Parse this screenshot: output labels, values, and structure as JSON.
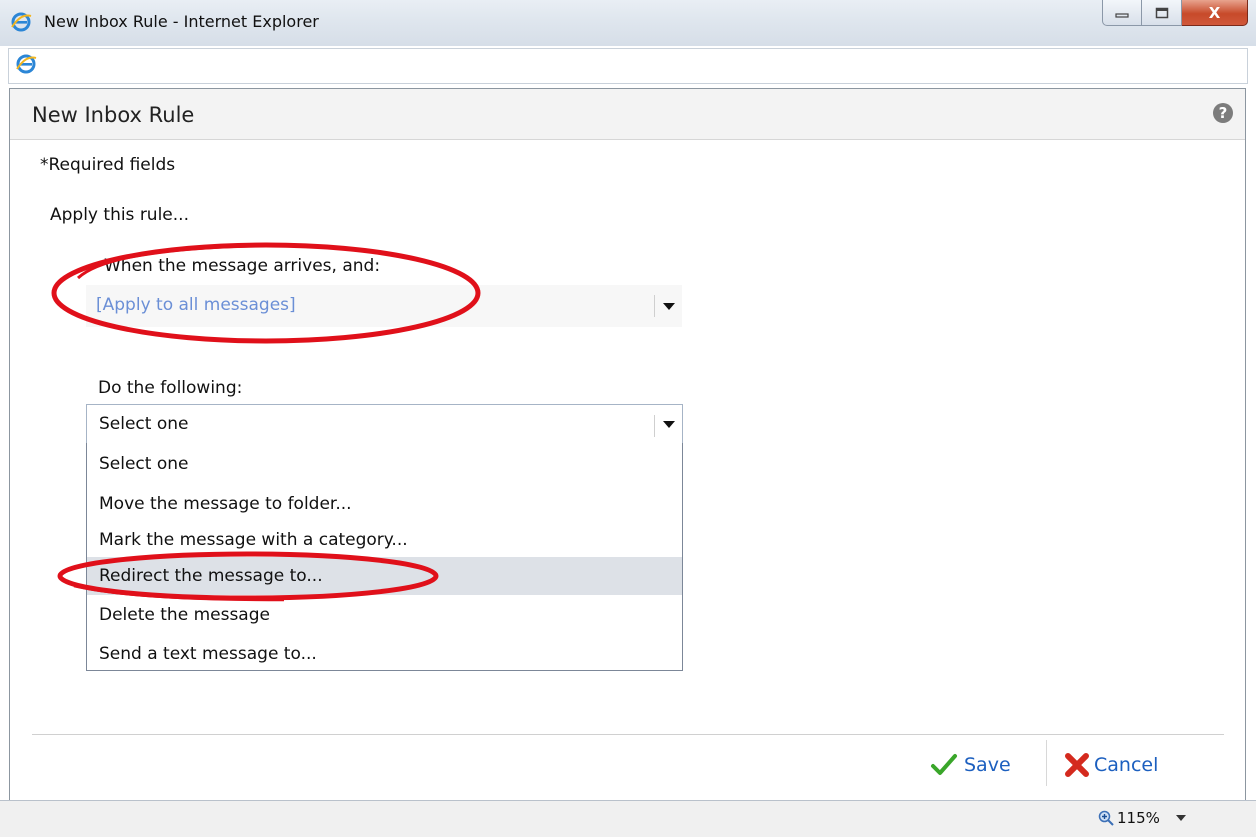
{
  "window": {
    "title": "New Inbox Rule - Internet Explorer",
    "minimize_label": "",
    "maximize_label": "",
    "close_label": "X"
  },
  "page": {
    "title": "New Inbox Rule",
    "help_label": "?",
    "required_note": "*Required fields",
    "apply_label": "Apply this rule...",
    "condition_label": "When the message arrives, and:",
    "condition_value": "[Apply to all messages]",
    "action_label": "Do the following:",
    "action_value": "Select one",
    "action_options": [
      "Select one",
      "Move the message to folder...",
      "Mark the message with a category...",
      "Redirect the message to...",
      "Delete the message",
      "Send a text message to..."
    ],
    "highlighted_option_index": 3
  },
  "footer": {
    "save_label": "Save",
    "cancel_label": "Cancel"
  },
  "status": {
    "zoom": "115%"
  },
  "colors": {
    "link_blue": "#1c5fbf",
    "annotation_red": "#e0101a",
    "save_check": "#3aa62a",
    "cancel_x": "#d42a1e"
  }
}
